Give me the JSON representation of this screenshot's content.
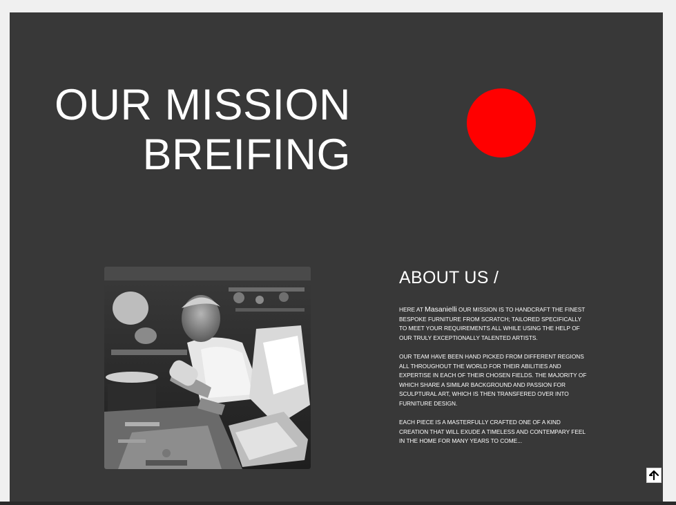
{
  "hero": {
    "title_line1": "OUR MISSION",
    "title_line2": "BREIFING",
    "accent_color": "#ff0000"
  },
  "about": {
    "heading": "ABOUT US /",
    "p1_prefix": "HERE AT ",
    "p1_brand": "Masanielli",
    "p1_rest": " OUR MISSION IS TO HANDCRAFT THE FINEST BESPOKE FURNITURE FROM SCRATCH; TAILORED SPECIFICALLY TO MEET YOUR REQUIREMENTS ALL WHILE USING THE HELP OF OUR TRULY EXCEPTIONALLY TALENTED ARTISTS.",
    "p2": "OUR TEAM HAVE BEEN HAND PICKED FROM DIFFERENT REGIONS ALL THROUGHOUT THE WORLD FOR THEIR ABILITIES AND EXPERTISE IN EACH OF THEIR CHOSEN FIELDS. THE MAJORITY OF WHICH SHARE A SIMILAR BACKGROUND AND PASSION FOR SCULPTURAL ART, WHICH IS THEN TRANSFERED OVER INTO FURNITURE DESIGN.",
    "p3": "EACH PIECE IS A MASTERFULLY CRAFTED ONE OF A KIND CREATION THAT WILL EXUDE A TIMELESS AND CONTEMPARY FEEL IN THE HOME FOR MANY YEARS TO COME..."
  },
  "photo": {
    "icon": "craftsman-carving-photo"
  },
  "controls": {
    "scroll_top_icon": "arrow-up-icon"
  },
  "colors": {
    "page_background": "#383838",
    "text": "#ffffff",
    "outer_background": "#f0f0f0"
  }
}
